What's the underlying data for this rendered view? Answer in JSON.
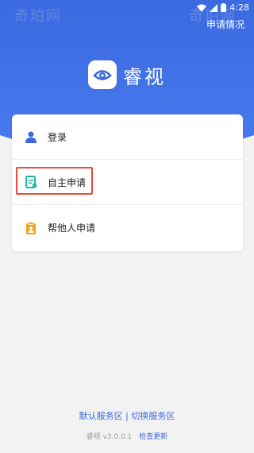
{
  "status_bar": {
    "time": "4:28",
    "icons": [
      "wifi-icon",
      "signal-icon",
      "battery-icon"
    ]
  },
  "watermark": "奇珀网",
  "header": {
    "apply_status": "申请情况",
    "brand_name": "睿视",
    "brand_icon": "eye-logo-icon"
  },
  "menu": {
    "items": [
      {
        "label": "登录",
        "icon": "user-icon",
        "icon_color": "#3b6ae0"
      },
      {
        "label": "自主申请",
        "icon": "document-icon",
        "icon_color": "#1fb8a0"
      },
      {
        "label": "帮他人申请",
        "icon": "clipboard-user-icon",
        "icon_color": "#f2a319"
      }
    ]
  },
  "footer": {
    "default_server": "默认服务区",
    "separator": "|",
    "switch_server": "切换服务区",
    "version": "睿视 v3.0.0.1",
    "check_update": "检查更新"
  },
  "colors": {
    "primary": "#3b6ae0",
    "highlight_border": "#e74c3c"
  }
}
